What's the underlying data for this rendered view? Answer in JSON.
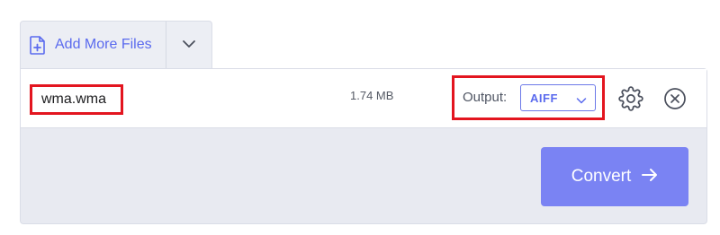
{
  "toolbar": {
    "add_files_label": "Add More Files",
    "add_files_icon": "file-plus-icon",
    "dropdown_icon": "chevron-down-icon"
  },
  "file": {
    "name": "wma.wma",
    "size": "1.74 MB",
    "output_label": "Output:",
    "output_format": "AIFF",
    "settings_icon": "gear-icon",
    "remove_icon": "close-circle-icon"
  },
  "convert": {
    "label": "Convert",
    "icon": "arrow-right-icon"
  },
  "colors": {
    "accent": "#5a6aee",
    "convert_button": "#7a83f3",
    "highlight": "#e3151f"
  }
}
